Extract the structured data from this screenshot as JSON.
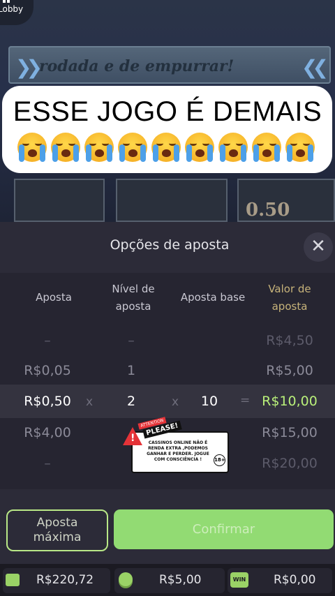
{
  "game": {
    "lobby_label": "Lobby",
    "banner_text": "rodada e de empurrar!",
    "reel_value": "0.50"
  },
  "caption": {
    "title": "ESSE JOGO É DEMAIS",
    "emoji_name": "loudly-crying-face",
    "emoji_count": 9
  },
  "panel": {
    "title": "Opções de aposta",
    "headers": {
      "bet": "Aposta",
      "level_line1": "Nível de",
      "level_line2": "aposta",
      "base": "Aposta base",
      "total_line1": "Valor de",
      "total_line2": "aposta"
    },
    "rows": [
      {
        "bet": "–",
        "level": "–",
        "total": "R$4,50"
      },
      {
        "bet": "R$0,05",
        "level": "1",
        "total": "R$5,00"
      },
      {
        "bet": "R$0,50",
        "level": "2",
        "base": "10",
        "total": "R$10,00"
      },
      {
        "bet": "R$4,00",
        "level": "",
        "total": "R$15,00"
      },
      {
        "bet": "–",
        "level": "",
        "total": "R$20,00"
      }
    ],
    "times_symbol": "x",
    "equals_symbol": "="
  },
  "notice": {
    "attention": "ATTENTION",
    "please": "PLEASE!",
    "text": "CASSINOS ONLINE NÃO É RENDA EXTRA ,PODEMOS GANHAR E PERDER. JOGUE COM CONSCIÊNCIA !",
    "age": "18+"
  },
  "buttons": {
    "max_bet_line1": "Aposta",
    "max_bet_line2": "máxima",
    "confirm": "Confirmar"
  },
  "status": {
    "balance": "R$220,72",
    "bet": "R$5,00",
    "win": "R$0,00",
    "win_icon_label": "WIN"
  },
  "colors": {
    "accent_green": "#92db73",
    "highlight_text": "#b9f07a",
    "gold_header": "#c7b37a"
  }
}
